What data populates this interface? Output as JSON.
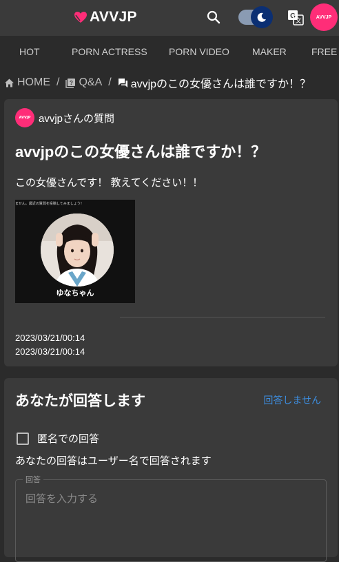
{
  "header": {
    "logo_text": "AVVJP",
    "avatar_text": "AVVJP",
    "brand_color": "#ff2d78",
    "icons": [
      "search-icon",
      "dark-mode-toggle",
      "translate-icon"
    ]
  },
  "nav": {
    "items": [
      {
        "label": "HOT"
      },
      {
        "label": "PORN ACTRESS"
      },
      {
        "label": "PORN VIDEO"
      },
      {
        "label": "MAKER"
      },
      {
        "label": "FREE"
      }
    ]
  },
  "breadcrumb": {
    "home": "HOME",
    "qa": "Q&A",
    "current": "avvjpのこの女優さんは誰ですか！？"
  },
  "question": {
    "avatar_text": "AVVJP",
    "asker": "avvjpさんの質問",
    "title": "avvjpのこの女優さんは誰ですか！？",
    "body": "この女優さんです！ 教えてください！！",
    "image_top_caption": "ません。最近の質問を投稿してみましょう！",
    "image_name": "ゆなちゃん",
    "date_created": "2023/03/21/00:14",
    "date_updated": "2023/03/21/00:14"
  },
  "answer": {
    "heading": "あなたが回答します",
    "cancel_label": "回答しません",
    "anonymous_label": "匿名での回答",
    "anonymous_checked": false,
    "note": "あなたの回答はユーザー名で回答されます",
    "field_legend": "回答",
    "field_placeholder": "回答を入力する",
    "link_color": "#3d8ee0"
  }
}
